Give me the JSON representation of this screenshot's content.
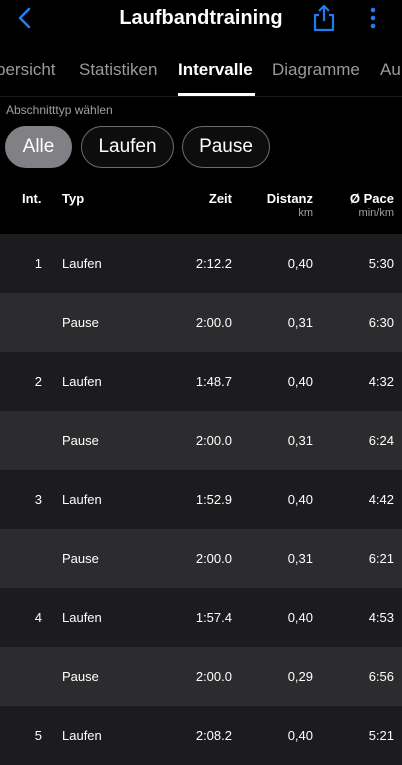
{
  "header": {
    "title": "Laufbandtraining"
  },
  "tabs": [
    "bersicht",
    "Statistiken",
    "Intervalle",
    "Diagramme",
    "Au"
  ],
  "section_label": "Abschnitttyp wählen",
  "chips": [
    "Alle",
    "Laufen",
    "Pause"
  ],
  "columns": {
    "int": "Int.",
    "typ": "Typ",
    "zeit": "Zeit",
    "distanz": "Distanz",
    "distanz_unit": "km",
    "pace": "Ø Pace",
    "pace_unit": "min/km"
  },
  "rows": [
    {
      "int": "1",
      "typ": "Laufen",
      "zeit": "2:12.2",
      "distanz": "0,40",
      "pace": "5:30"
    },
    {
      "int": "",
      "typ": "Pause",
      "zeit": "2:00.0",
      "distanz": "0,31",
      "pace": "6:30"
    },
    {
      "int": "2",
      "typ": "Laufen",
      "zeit": "1:48.7",
      "distanz": "0,40",
      "pace": "4:32"
    },
    {
      "int": "",
      "typ": "Pause",
      "zeit": "2:00.0",
      "distanz": "0,31",
      "pace": "6:24"
    },
    {
      "int": "3",
      "typ": "Laufen",
      "zeit": "1:52.9",
      "distanz": "0,40",
      "pace": "4:42"
    },
    {
      "int": "",
      "typ": "Pause",
      "zeit": "2:00.0",
      "distanz": "0,31",
      "pace": "6:21"
    },
    {
      "int": "4",
      "typ": "Laufen",
      "zeit": "1:57.4",
      "distanz": "0,40",
      "pace": "4:53"
    },
    {
      "int": "",
      "typ": "Pause",
      "zeit": "2:00.0",
      "distanz": "0,29",
      "pace": "6:56"
    },
    {
      "int": "5",
      "typ": "Laufen",
      "zeit": "2:08.2",
      "distanz": "0,40",
      "pace": "5:21"
    }
  ],
  "colors": {
    "accent": "#1e7ef0",
    "row_dark": "#1c1c1e",
    "row_light": "#2c2c2e"
  },
  "icons": {
    "back": "chevron-left-icon",
    "share": "share-icon",
    "more": "more-vertical-icon"
  }
}
